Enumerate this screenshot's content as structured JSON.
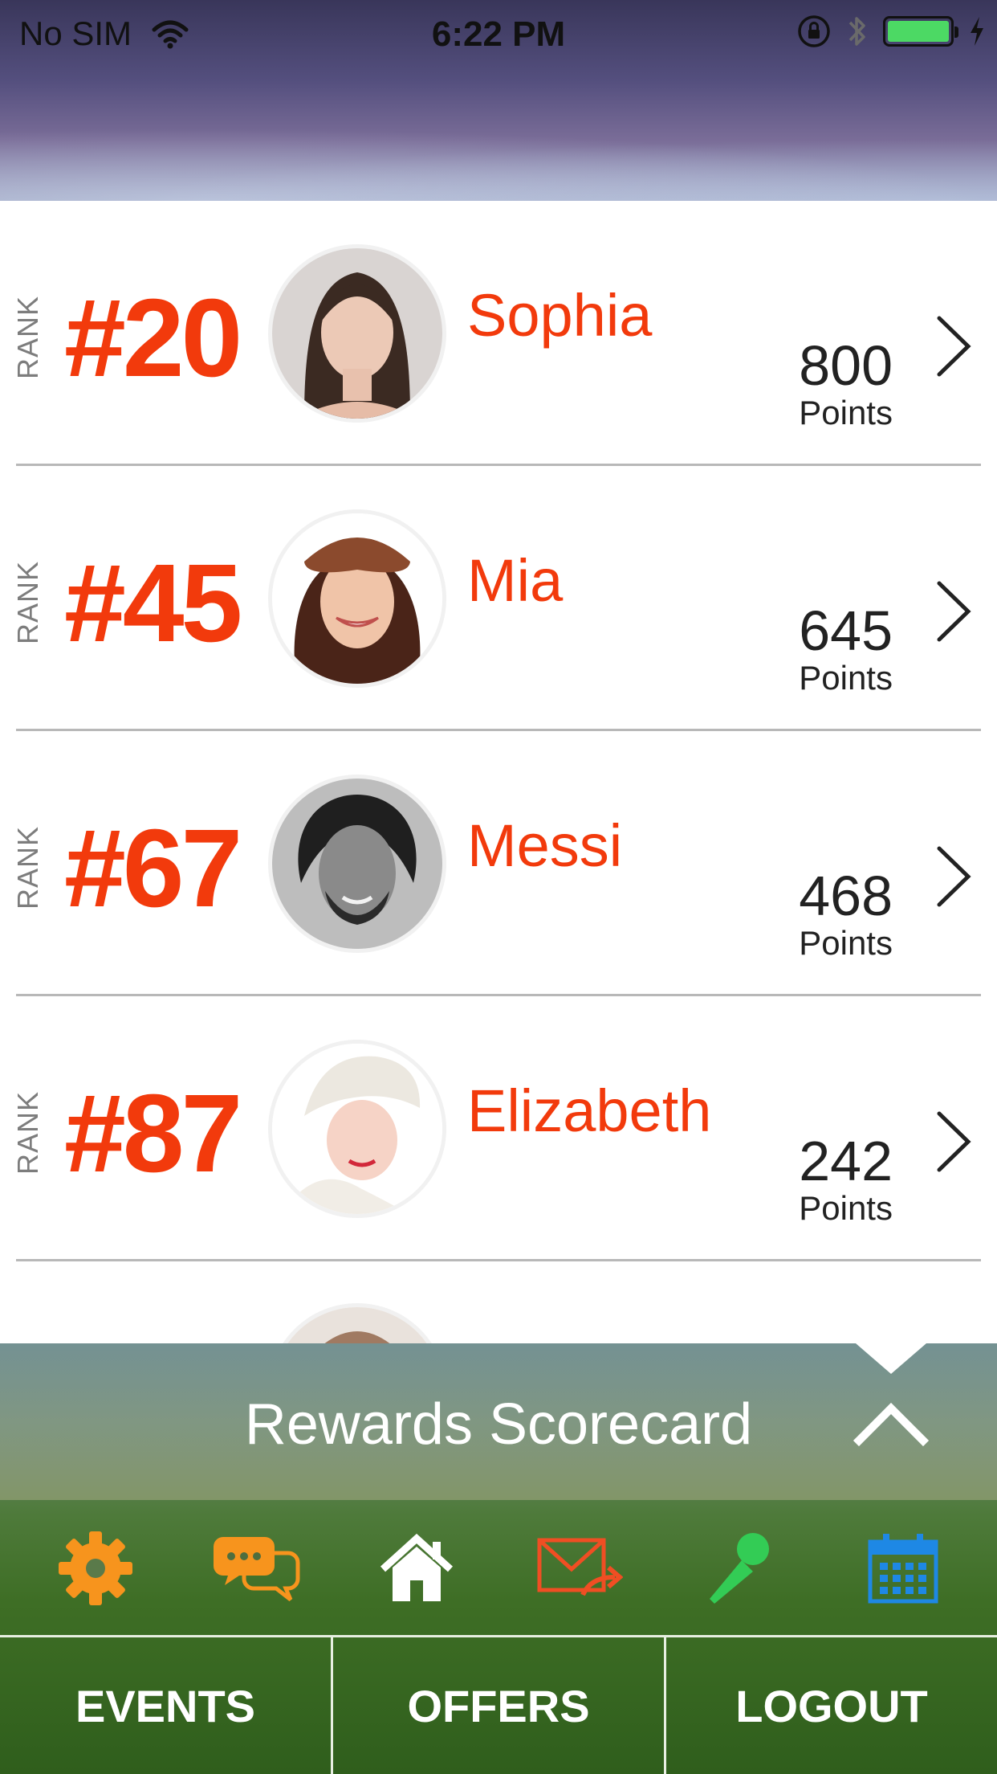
{
  "status_bar": {
    "carrier": "No SIM",
    "time": "6:22 PM",
    "battery_color": "#4cd964"
  },
  "leaderboard": {
    "rank_label": "RANK",
    "points_label": "Points",
    "accent_color": "#f23a0c",
    "rows": [
      {
        "rank": "#20",
        "name": "Sophia",
        "points": "800",
        "avatar_icon": "avatar-photo"
      },
      {
        "rank": "#45",
        "name": "Mia",
        "points": "645",
        "avatar_icon": "avatar-photo"
      },
      {
        "rank": "#67",
        "name": "Messi",
        "points": "468",
        "avatar_icon": "avatar-photo"
      },
      {
        "rank": "#87",
        "name": "Elizabeth",
        "points": "242",
        "avatar_icon": "avatar-photo"
      }
    ]
  },
  "panel": {
    "title": "Rewards Scorecard",
    "icons": [
      {
        "name": "settings-gear-icon",
        "color": "#f7941d"
      },
      {
        "name": "chat-bubbles-icon",
        "color": "#f7941d"
      },
      {
        "name": "home-icon",
        "color": "#ffffff"
      },
      {
        "name": "mail-forward-icon",
        "color": "#f04e23"
      },
      {
        "name": "microphone-icon",
        "color": "#33cc55"
      },
      {
        "name": "calendar-icon",
        "color": "#1e88e5"
      }
    ]
  },
  "tabs": [
    {
      "label": "EVENTS"
    },
    {
      "label": "OFFERS"
    },
    {
      "label": "LOGOUT"
    }
  ]
}
